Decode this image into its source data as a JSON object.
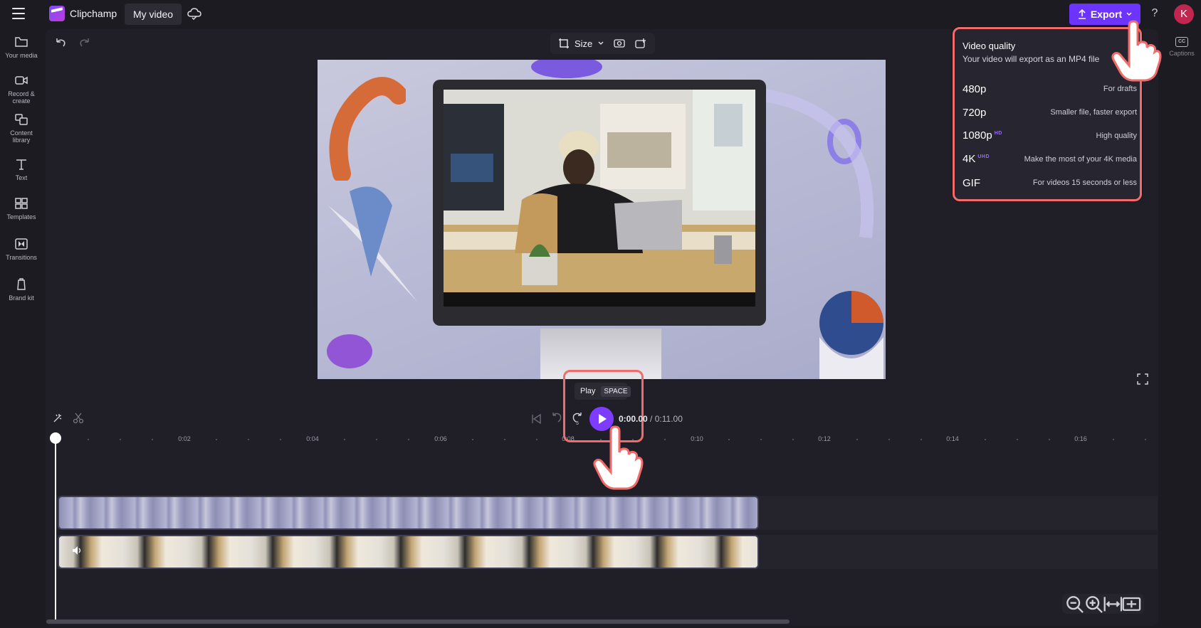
{
  "topbar": {
    "app_name": "Clipchamp",
    "project_name": "My video",
    "export_label": "Export",
    "avatar_initial": "K"
  },
  "sidebar": {
    "items": [
      {
        "label": "Your media",
        "icon": "folder-icon"
      },
      {
        "label": "Record & create",
        "icon": "camera-icon"
      },
      {
        "label": "Content library",
        "icon": "library-icon"
      },
      {
        "label": "Text",
        "icon": "text-icon"
      },
      {
        "label": "Templates",
        "icon": "templates-icon"
      },
      {
        "label": "Transitions",
        "icon": "transitions-icon"
      },
      {
        "label": "Brand kit",
        "icon": "brand-kit-icon"
      }
    ]
  },
  "canvas_toolbar": {
    "size_label": "Size"
  },
  "right_panel": {
    "captions_label": "Captions",
    "cc_icon_text": "CC"
  },
  "export_menu": {
    "title": "Video quality",
    "subtitle": "Your video will export as an MP4 file",
    "options": [
      {
        "label": "480p",
        "badge": "",
        "desc": "For drafts"
      },
      {
        "label": "720p",
        "badge": "",
        "desc": "Smaller file, faster export"
      },
      {
        "label": "1080p",
        "badge": "HD",
        "desc": "High quality"
      },
      {
        "label": "4K",
        "badge": "UHD",
        "desc": "Make the most of your 4K media"
      },
      {
        "label": "GIF",
        "badge": "",
        "desc": "For videos 15 seconds or less"
      }
    ]
  },
  "playback": {
    "tooltip_label": "Play",
    "tooltip_key": "SPACE",
    "current_time": "0:00.00",
    "separator": "/",
    "duration": "0:11.00",
    "skip_back_label": "5",
    "skip_forward_label": "5"
  },
  "timeline": {
    "ruler_labels": [
      "0:02",
      "0:04",
      "0:06",
      "0:08",
      "0:10",
      "0:12",
      "0:14",
      "0:16"
    ]
  },
  "colors": {
    "accent": "#7d3cff",
    "highlight": "#f26b6b",
    "background": "#1c1b22"
  }
}
